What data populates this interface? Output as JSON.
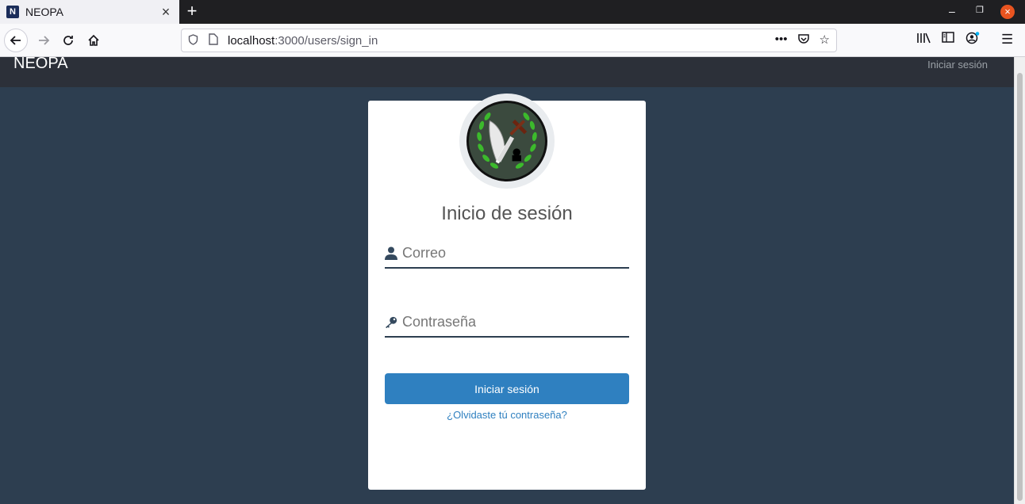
{
  "browser": {
    "tab_title": "NEOPA",
    "tab_favicon_letter": "N",
    "url_host": "localhost",
    "url_rest": ":3000/users/sign_in"
  },
  "header": {
    "brand": "NEOPA",
    "login_link": "Iniciar sesión"
  },
  "login": {
    "title": "Inicio de sesión",
    "email_placeholder": "Correo",
    "password_placeholder": "Contraseña",
    "submit_label": "Iniciar sesión",
    "forgot_link": "¿Olvidaste tú contraseña?"
  },
  "colors": {
    "page_bg": "#2d3e50",
    "primary": "#2f80c0",
    "header_bg": "#2c3039"
  }
}
